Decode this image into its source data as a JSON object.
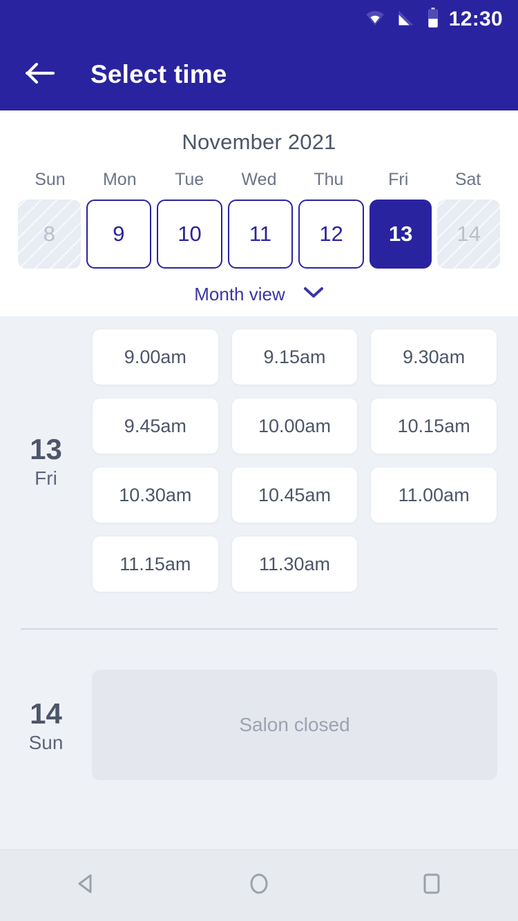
{
  "status_bar": {
    "time": "12:30",
    "icons": [
      "wifi-icon",
      "signal-icon",
      "battery-icon"
    ]
  },
  "app_bar": {
    "back_icon": "arrow-left-icon",
    "title": "Select time"
  },
  "calendar": {
    "month_title": "November 2021",
    "weekdays": [
      "Sun",
      "Mon",
      "Tue",
      "Wed",
      "Thu",
      "Fri",
      "Sat"
    ],
    "days": [
      {
        "num": "8",
        "state": "disabled"
      },
      {
        "num": "9",
        "state": "available"
      },
      {
        "num": "10",
        "state": "available"
      },
      {
        "num": "11",
        "state": "available"
      },
      {
        "num": "12",
        "state": "available"
      },
      {
        "num": "13",
        "state": "selected"
      },
      {
        "num": "14",
        "state": "disabled"
      }
    ],
    "month_view_label": "Month view",
    "month_view_icon": "chevron-down-icon"
  },
  "schedule": [
    {
      "day_number": "13",
      "day_name": "Fri",
      "slots": [
        "9.00am",
        "9.15am",
        "9.30am",
        "9.45am",
        "10.00am",
        "10.15am",
        "10.30am",
        "10.45am",
        "11.00am",
        "11.15am",
        "11.30am"
      ],
      "closed_message": null
    },
    {
      "day_number": "14",
      "day_name": "Sun",
      "slots": [],
      "closed_message": "Salon closed"
    }
  ],
  "nav_bar": {
    "back": "nav-back-icon",
    "home": "nav-home-icon",
    "recents": "nav-recents-icon"
  },
  "colors": {
    "primary": "#2a23a0",
    "background": "#eef1f6",
    "card": "#ffffff",
    "text_dark": "#4c5569",
    "text_muted": "#9aa3b4",
    "disabled_cell": "#e8ecf3",
    "closed_box": "#e4e8ee"
  }
}
